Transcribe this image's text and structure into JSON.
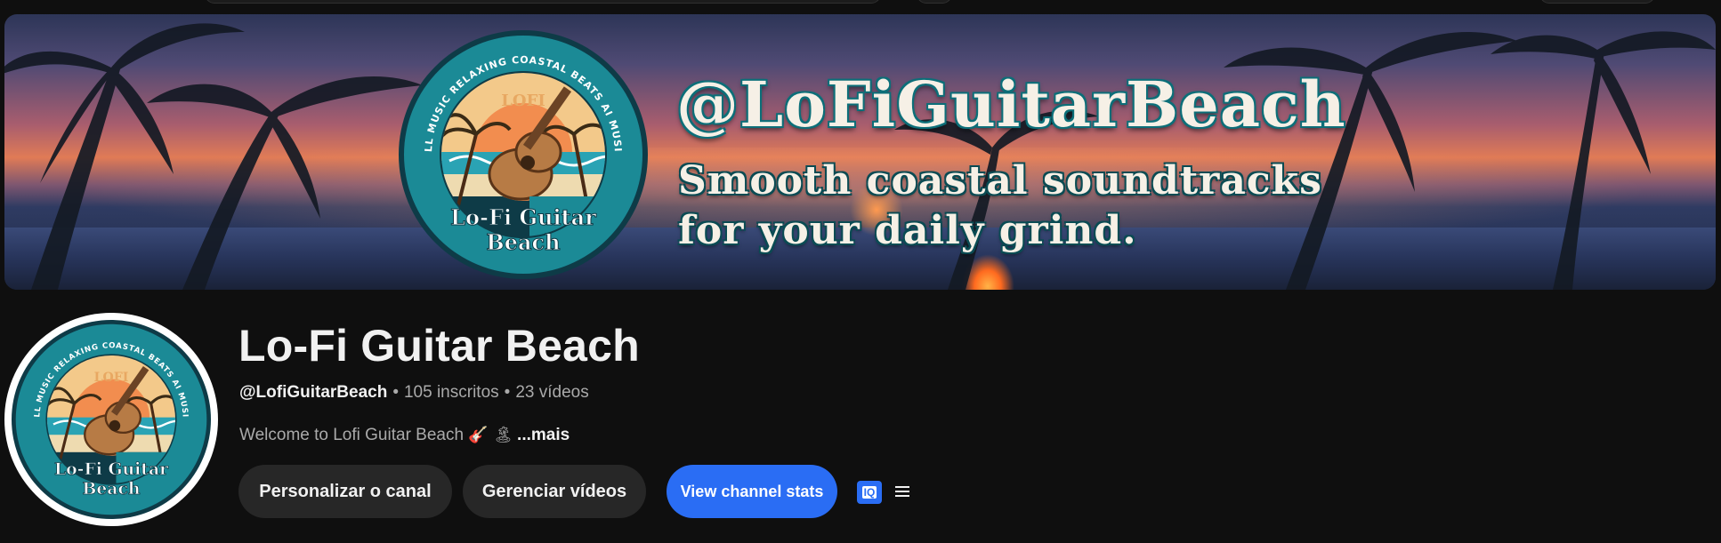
{
  "banner": {
    "handle": "@LoFiGuitarBeach",
    "tagline_line1": "Smooth coastal soundtracks",
    "tagline_line2": "for your daily grind.",
    "logo": {
      "arc_text": "ALL MUSIC RELAXING COASTAL BEATS AI MUSIC",
      "top_word": "LOFI",
      "name_line1": "Lo-Fi Guitar",
      "name_line2": "Beach"
    }
  },
  "channel": {
    "name": "Lo-Fi Guitar Beach",
    "handle": "@LofiGuitarBeach",
    "subscribers": "105 inscritos",
    "videos": "23 vídeos",
    "separator": "•",
    "description": "Welcome to Lofi Guitar Beach",
    "description_emojis": "🎸 🏝",
    "more_label": "...mais"
  },
  "actions": {
    "customize_label": "Personalizar o canal",
    "manage_label": "Gerenciar vídeos",
    "stats_label": "View channel stats",
    "iq_label": "IQ"
  },
  "icons": {
    "iq": "vidiq-icon",
    "menu": "hamburger-menu-icon"
  },
  "colors": {
    "background": "#0f0f0f",
    "button_bg": "#272727",
    "accent_blue": "#2a6df4",
    "logo_teal": "#1b8a96"
  }
}
